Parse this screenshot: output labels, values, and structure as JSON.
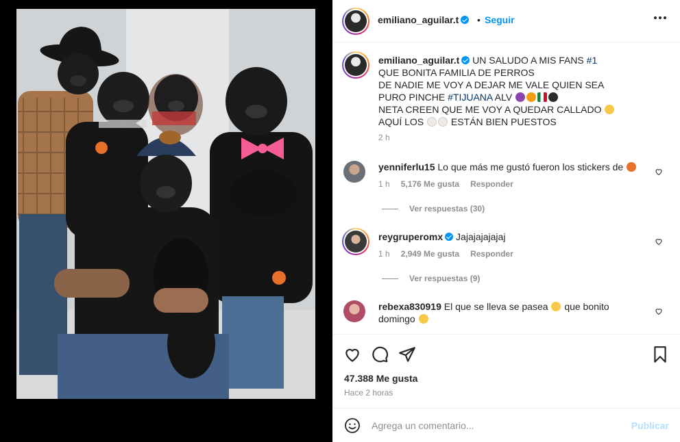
{
  "header": {
    "username": "emiliano_aguilar.t",
    "separator": "•",
    "follow_label": "Seguir"
  },
  "caption": {
    "username": "emiliano_aguilar.t",
    "lines": [
      "UN SALUDO A MIS FANS",
      "QUE BONITA FAMILIA DE PERROS",
      "DE NADIE ME VOY A DEJAR ME VALE QUIEN SEA",
      "PURO PINCHE",
      "ALV",
      "NETA CREEN QUE ME VOY A QUEDAR CALLADO",
      "AQUÍ LOS",
      "ESTÁN BIEN PUESTOS"
    ],
    "hashtag_1": "#1",
    "hashtag_tijuana": "#TIJUANA",
    "time": "2 h"
  },
  "comments": [
    {
      "username": "yenniferlu15",
      "text": "Lo que más me gustó fueron los stickers de",
      "time": "1 h",
      "likes": "5,176 Me gusta",
      "reply": "Responder",
      "view_replies": "Ver respuestas (30)"
    },
    {
      "username": "reygruperomx",
      "text": "Jajajajajajaj",
      "time": "1 h",
      "likes": "2,949 Me gusta",
      "reply": "Responder",
      "view_replies": "Ver respuestas (9)"
    },
    {
      "username": "rebexa830919",
      "text_a": "El que se lleva se pasea",
      "text_b": "que bonito",
      "text_c": "domingo"
    }
  ],
  "actions": {
    "likes": "47.388 Me gusta",
    "posted": "Hace 2 horas"
  },
  "add_comment": {
    "placeholder": "Agrega un comentario...",
    "publish_label": "Publicar"
  },
  "icons": [
    "heart-icon",
    "comment-icon",
    "share-icon",
    "bookmark-icon",
    "emoji-icon",
    "more-icon",
    "verified-icon"
  ],
  "colors": {
    "accent": "#0095f6",
    "hashtag": "#00376b",
    "muted": "#8e8e8e",
    "publish_disabled": "#b2dffc"
  }
}
